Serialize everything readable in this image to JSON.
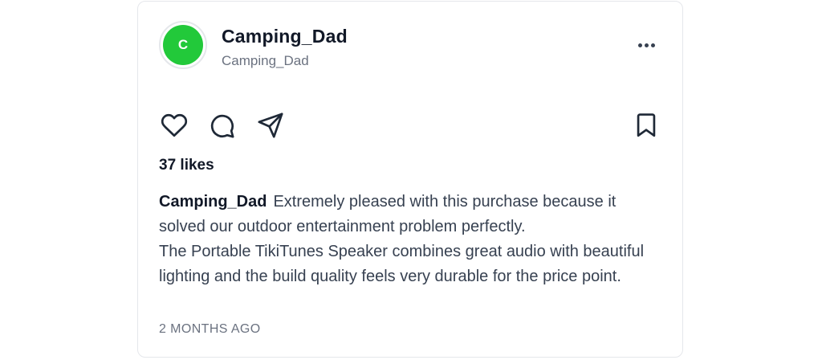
{
  "post": {
    "author": {
      "avatar_initial": "C",
      "avatar_color": "#22c93a",
      "display_name": "Camping_Dad",
      "handle": "Camping_Dad"
    },
    "more_icon": "more-horizontal-icon",
    "actions": {
      "like_icon": "heart-icon",
      "comment_icon": "comment-icon",
      "share_icon": "send-icon",
      "save_icon": "bookmark-icon",
      "icon_color": "#1f2937"
    },
    "likes_text": "37 likes",
    "caption": {
      "username": "Camping_Dad",
      "line1": "Extremely pleased with this purchase because it solved our outdoor entertainment problem perfectly.",
      "line2": "The Portable TikiTunes Speaker combines great audio with beautiful lighting and the build quality feels very durable for the price point."
    },
    "timestamp": "2 MONTHS AGO"
  }
}
